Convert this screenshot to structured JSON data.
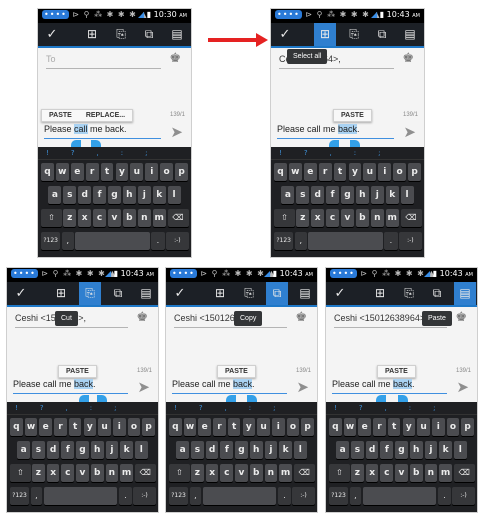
{
  "status": {
    "left_icons": "•••• ⊳ ⚲ ⁂ ✱ ✱ ✱ ▲",
    "left_first": "••••",
    "signal_glyph": "◢",
    "battery_glyph": "▮",
    "times": [
      "10:30",
      "10:43",
      "10:43",
      "10:43",
      "10:43"
    ],
    "am": "AM"
  },
  "actionbar": {
    "done_glyph": "✓",
    "select_all_glyph": "⊞",
    "cut_glyph": "⎘",
    "copy_glyph": "⧉",
    "paste_glyph": "▤",
    "active_color": "#2f7fcf"
  },
  "screens": [
    {
      "to_text": "To",
      "to_is_hint": true,
      "popup": "",
      "active": "none"
    },
    {
      "to_text": "Ce         12638964>,",
      "to_is_hint": false,
      "popup": "Select all",
      "active": "select_all"
    },
    {
      "to_text": "Ceshi <15        8964>,",
      "to_is_hint": false,
      "popup": "Cut",
      "active": "cut"
    },
    {
      "to_text": "Ceshi <1501263",
      "to_is_hint": false,
      "popup": "Copy",
      "active": "copy"
    },
    {
      "to_text": "Ceshi <15012638964>,",
      "to_is_hint": false,
      "popup": "Paste",
      "active": "paste"
    }
  ],
  "paste_bar": {
    "paste": "PASTE",
    "replace": "REPLACE..."
  },
  "counter": "139/1",
  "compose": {
    "screen1": {
      "before": "Please ",
      "selected": "call",
      "after": " me back."
    },
    "others": {
      "before": "Please call me ",
      "selected": "back",
      "after": "."
    }
  },
  "contact_glyph": "♚",
  "send_glyph": "➤",
  "keyboard": {
    "suggestions": [
      "!",
      "?",
      ",",
      ":",
      ";"
    ],
    "row1": [
      "q",
      "w",
      "e",
      "r",
      "t",
      "y",
      "u",
      "i",
      "o",
      "p"
    ],
    "row2": [
      "a",
      "s",
      "d",
      "f",
      "g",
      "h",
      "j",
      "k",
      "l"
    ],
    "row3": [
      "z",
      "x",
      "c",
      "v",
      "b",
      "n",
      "m"
    ],
    "shift": "⇧",
    "delete": "⌫",
    "mode": "?123",
    "comma": ",",
    "period": ".",
    "enter": ":-)"
  },
  "colors": {
    "arrow": "#e52222",
    "accent": "#1e78c8",
    "handle": "#33a0e8"
  }
}
